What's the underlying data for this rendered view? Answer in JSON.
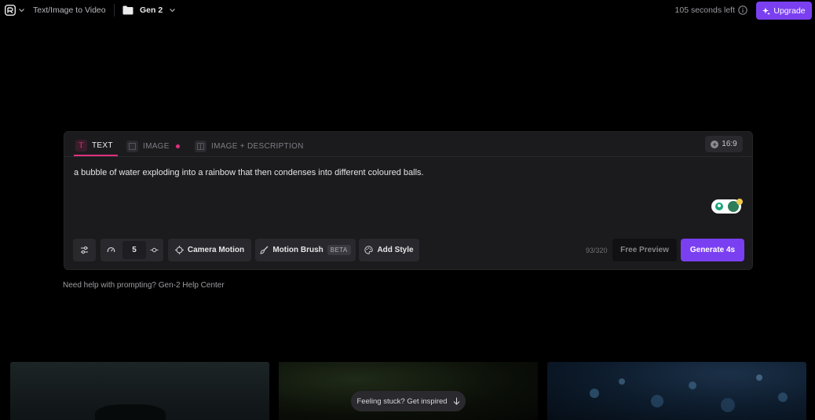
{
  "topbar": {
    "breadcrumb": "Text/Image to Video",
    "project": "Gen 2",
    "seconds_left": "105 seconds left",
    "upgrade_label": "Upgrade"
  },
  "tabs": [
    {
      "label": "TEXT",
      "active": true
    },
    {
      "label": "IMAGE",
      "active": false
    },
    {
      "label": "IMAGE + DESCRIPTION",
      "active": false
    }
  ],
  "aspect_ratio": "16:9",
  "prompt": {
    "value": "a bubble of water exploding into a rainbow that then condenses into different coloured balls."
  },
  "toolbar": {
    "speed_value": "5",
    "camera_motion_label": "Camera Motion",
    "motion_brush_label": "Motion Brush",
    "beta_badge": "BETA",
    "add_style_label": "Add Style",
    "char_count": "93/320",
    "free_preview_label": "Free Preview",
    "generate_label": "Generate 4s"
  },
  "help": {
    "text": "Need help with prompting? Gen-2 Help Center"
  },
  "inspire": {
    "label": "Feeling stuck? Get inspired"
  },
  "colors": {
    "accent": "#7b3ff2",
    "tab_indicator": "#e0307f",
    "panel_bg": "#1b1b1e",
    "page_bg": "#000000"
  },
  "icons": [
    "runway-logo-icon",
    "chevron-down-icon",
    "folder-icon",
    "info-icon",
    "sparkle-icon",
    "text-icon",
    "image-icon",
    "image-description-icon",
    "plus-circle-icon",
    "settings-sliders-icon",
    "speedometer-icon",
    "slider-icon",
    "camera-motion-icon",
    "brush-icon",
    "palette-icon",
    "arrow-down-icon"
  ]
}
